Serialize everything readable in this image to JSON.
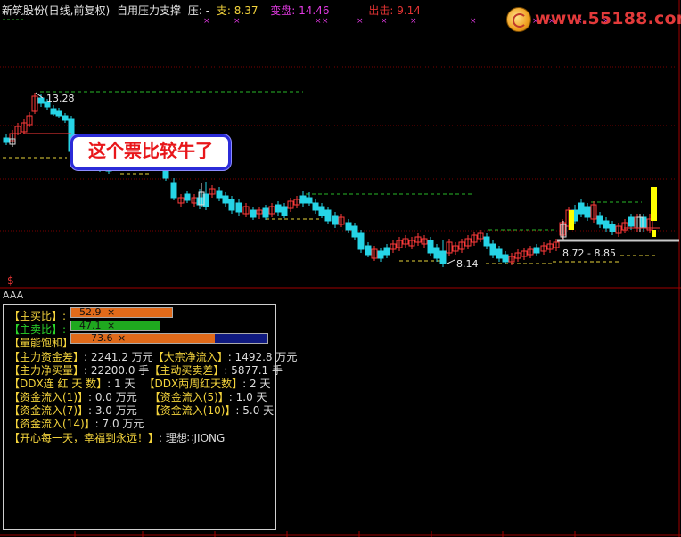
{
  "header": {
    "title": "新筑股份(日线,前复权)",
    "indicator": "自用压力支撑",
    "pressure_label": "压: -",
    "support_label": "支: 8.37",
    "change_label": "变盘: 14.46",
    "exit_label": "出击: 9.14"
  },
  "logo": {
    "text": "www.55188.com"
  },
  "annotation": {
    "text": "这个票比较牛了"
  },
  "chart_labels": {
    "high_price": "13.28",
    "low_price": "8.14",
    "range_label": "8.72 - 8.85",
    "sub_label": "AAA",
    "dollar": "$"
  },
  "colors": {
    "up": "#ff3a3a",
    "down": "#26d4e6",
    "green_line": "#28b828",
    "yellow_line": "#e8d43a",
    "magenta": "#e23ae2",
    "grid": "#7a0000",
    "signal_yellow": "#ffff00"
  },
  "panel": {
    "main_buy": {
      "label": "【主买比】:",
      "value": "52.9",
      "fill": 0.529,
      "suffix": "×"
    },
    "main_sell": {
      "label": "【主卖比】:",
      "value": "47.1",
      "fill": 0.471,
      "suffix": "×"
    },
    "volume_sat": {
      "label": "【量能饱和】",
      "value": "73.6",
      "fill": 0.736,
      "suffix": "×"
    },
    "row_main_fund": {
      "k1": "【主力资金差】",
      "v1": ": 2241.2 万元",
      "k2": "【大宗净流入】",
      "v2": ": 1492.8 万元"
    },
    "row_main_net": {
      "k1": "【主力净买量】",
      "v1": ": 22200.0 手",
      "k2": "【主动买卖差】",
      "v2": ": 5877.1 手"
    },
    "row_ddx": {
      "k1": "【DDX连 红 天 数】",
      "v1": ": 1 天",
      "k2": "【DDX两周红天数】",
      "v2": ": 2 天"
    },
    "row_flow1": {
      "k1": "【资金流入(1)】",
      "v1": ": 0.0 万元",
      "k2": "【资金流入(5)】",
      "v2": ": 1.0 天"
    },
    "row_flow7": {
      "k1": "【资金流入(7)】",
      "v1": ": 3.0 万元",
      "k2": "【资金流入(10)】",
      "v2": ": 5.0 天"
    },
    "row_flow14": {
      "k1": "【资金流入(14)】",
      "v1": ": 7.0 万元"
    },
    "motto": {
      "k1": "【开心每一天，幸福到永远！】",
      "v1": ": 理想∷JIONG"
    }
  }
}
